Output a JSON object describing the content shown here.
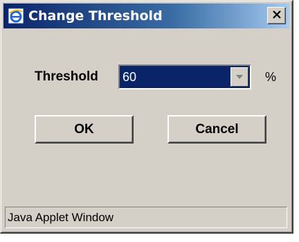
{
  "window": {
    "title": "Change Threshold",
    "app_icon": "internet-explorer-icon",
    "close_icon": "close-icon",
    "close_glyph": "×"
  },
  "form": {
    "threshold_label": "Threshold",
    "threshold_value": "60",
    "unit": "%",
    "dropdown_icon": "chevron-down-icon"
  },
  "buttons": {
    "ok_label": "OK",
    "cancel_label": "Cancel"
  },
  "status": {
    "text": "Java Applet Window"
  },
  "colors": {
    "title_bar": "#0a246a",
    "dialog_bg": "#d4d0c8",
    "selection": "#0a246a"
  }
}
